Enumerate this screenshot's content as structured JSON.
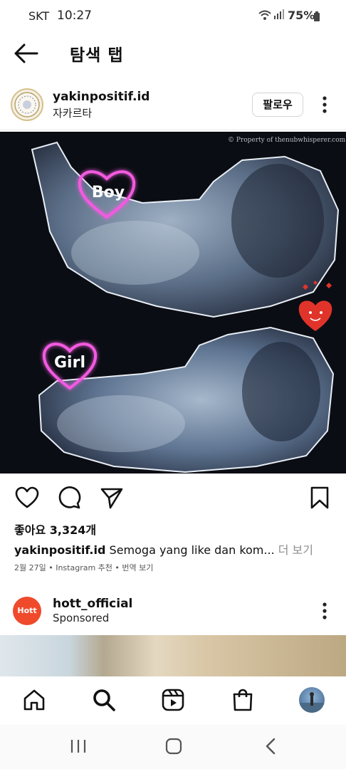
{
  "status_bar": {
    "carrier": "SKT",
    "time": "10:27",
    "battery": "75%"
  },
  "header": {
    "title": "탐색 탭"
  },
  "post": {
    "username": "yakinpositif.id",
    "location": "자카르타",
    "follow_label": "팔로우",
    "image": {
      "watermark": "© Property of thenubwhisperer.com",
      "label_top": "Boy",
      "label_bottom": "Girl"
    },
    "likes": "좋아요 3,324개",
    "caption_user": "yakinpositif.id",
    "caption_text": "Semoga yang like dan kom...",
    "caption_more": "더 보기",
    "meta": "2월 27일 • Instagram 추천 • 번역 보기"
  },
  "sponsored_post": {
    "avatar_text": "Hott",
    "username": "hott_official",
    "label": "Sponsored"
  },
  "colors": {
    "accent_heart": "#e040c8",
    "ad_brand": "#ef4a2c"
  }
}
